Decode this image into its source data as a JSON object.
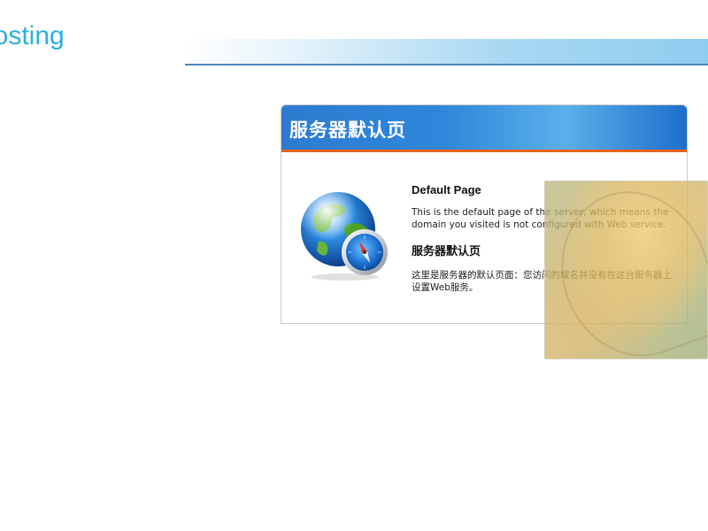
{
  "logo": {
    "text": "iosting"
  },
  "card": {
    "title": "服务器默认页",
    "heading_en": "Default Page",
    "text_en": "This is the default page of the server, which means the domain you visited is not configured with Web service.",
    "heading_cn": "服务器默认页",
    "text_cn": "这里是服务器的默认页面：您访问的域名并没有在这台服务器上设置Web服务。"
  },
  "icons": {
    "globe": "globe-compass-icon"
  },
  "colors": {
    "logo": "#2bb0dc",
    "title_bar": "#2f87da",
    "title_underline": "#e8641c",
    "header_band": "#8fcdef"
  }
}
